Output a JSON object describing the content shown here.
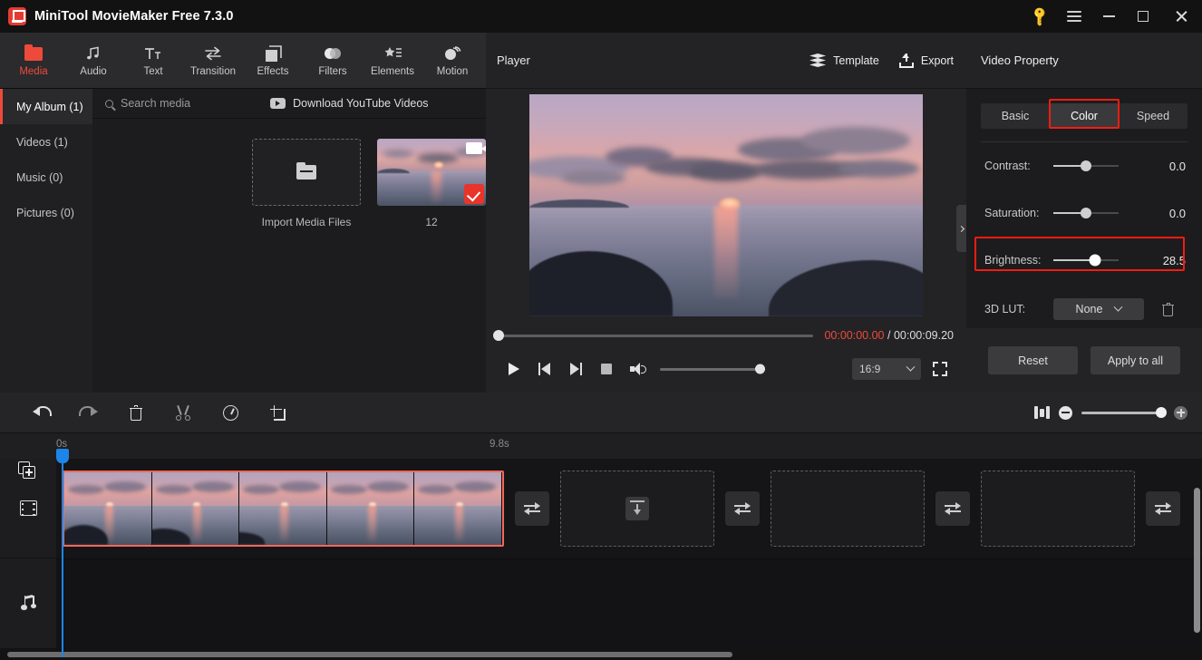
{
  "window": {
    "title": "MiniTool MovieMaker Free 7.3.0",
    "controls": {
      "key": "key-icon",
      "menu": "menu-icon",
      "minimize": "minimize",
      "maximize": "maximize",
      "close": "close"
    }
  },
  "ribbon": {
    "items": [
      {
        "label": "Media",
        "icon": "folder-icon",
        "active": true
      },
      {
        "label": "Audio",
        "icon": "music-note-icon",
        "active": false
      },
      {
        "label": "Text",
        "icon": "text-icon",
        "active": false
      },
      {
        "label": "Transition",
        "icon": "transition-arrows-icon",
        "active": false
      },
      {
        "label": "Effects",
        "icon": "layers-square-icon",
        "active": false
      },
      {
        "label": "Filters",
        "icon": "filters-circles-icon",
        "active": false
      },
      {
        "label": "Elements",
        "icon": "star-list-icon",
        "active": false
      },
      {
        "label": "Motion",
        "icon": "motion-ball-icon",
        "active": false
      }
    ]
  },
  "library": {
    "nav": [
      {
        "label": "My Album (1)",
        "active": true
      },
      {
        "label": "Videos (1)",
        "active": false
      },
      {
        "label": "Music (0)",
        "active": false
      },
      {
        "label": "Pictures (0)",
        "active": false
      }
    ],
    "search_placeholder": "Search media",
    "download_youtube": "Download YouTube Videos",
    "import_label": "Import Media Files",
    "media_items": [
      {
        "name": "12",
        "type": "video",
        "selected": true
      }
    ]
  },
  "player": {
    "title": "Player",
    "template_label": "Template",
    "export_label": "Export",
    "current_time": "00:00:00.00",
    "separator": "/",
    "total_time": "00:00:09.20",
    "aspect_ratio": "16:9",
    "volume_percent": 100,
    "seek_percent": 0
  },
  "properties": {
    "header": "Video Property",
    "tabs": [
      {
        "label": "Basic",
        "active": false,
        "highlighted": false
      },
      {
        "label": "Color",
        "active": true,
        "highlighted": true
      },
      {
        "label": "Speed",
        "active": false,
        "highlighted": false
      }
    ],
    "controls": [
      {
        "label": "Contrast:",
        "value": "0.0",
        "slider_percent": 50,
        "highlighted": false
      },
      {
        "label": "Saturation:",
        "value": "0.0",
        "slider_percent": 50,
        "highlighted": false
      },
      {
        "label": "Brightness:",
        "value": "28.5",
        "slider_percent": 64,
        "highlighted": true
      }
    ],
    "lut_label": "3D LUT:",
    "lut_value": "None",
    "reset_label": "Reset",
    "apply_all_label": "Apply to all",
    "highlight_color": "#f41c11"
  },
  "timeline": {
    "tools": [
      {
        "name": "undo",
        "enabled": true
      },
      {
        "name": "redo",
        "enabled": false
      },
      {
        "name": "delete",
        "enabled": true
      },
      {
        "name": "split",
        "enabled": false
      },
      {
        "name": "speed",
        "enabled": true
      },
      {
        "name": "crop",
        "enabled": true
      }
    ],
    "ruler_start": "0s",
    "ruler_end": "9.8s",
    "zoom_percent": 100,
    "tracks": [
      {
        "type": "video",
        "icon": "film-icon"
      },
      {
        "type": "audio",
        "icon": "music-note-icon"
      }
    ],
    "clip": {
      "selected": true,
      "frames": 5,
      "border_color": "#f4685a"
    }
  }
}
